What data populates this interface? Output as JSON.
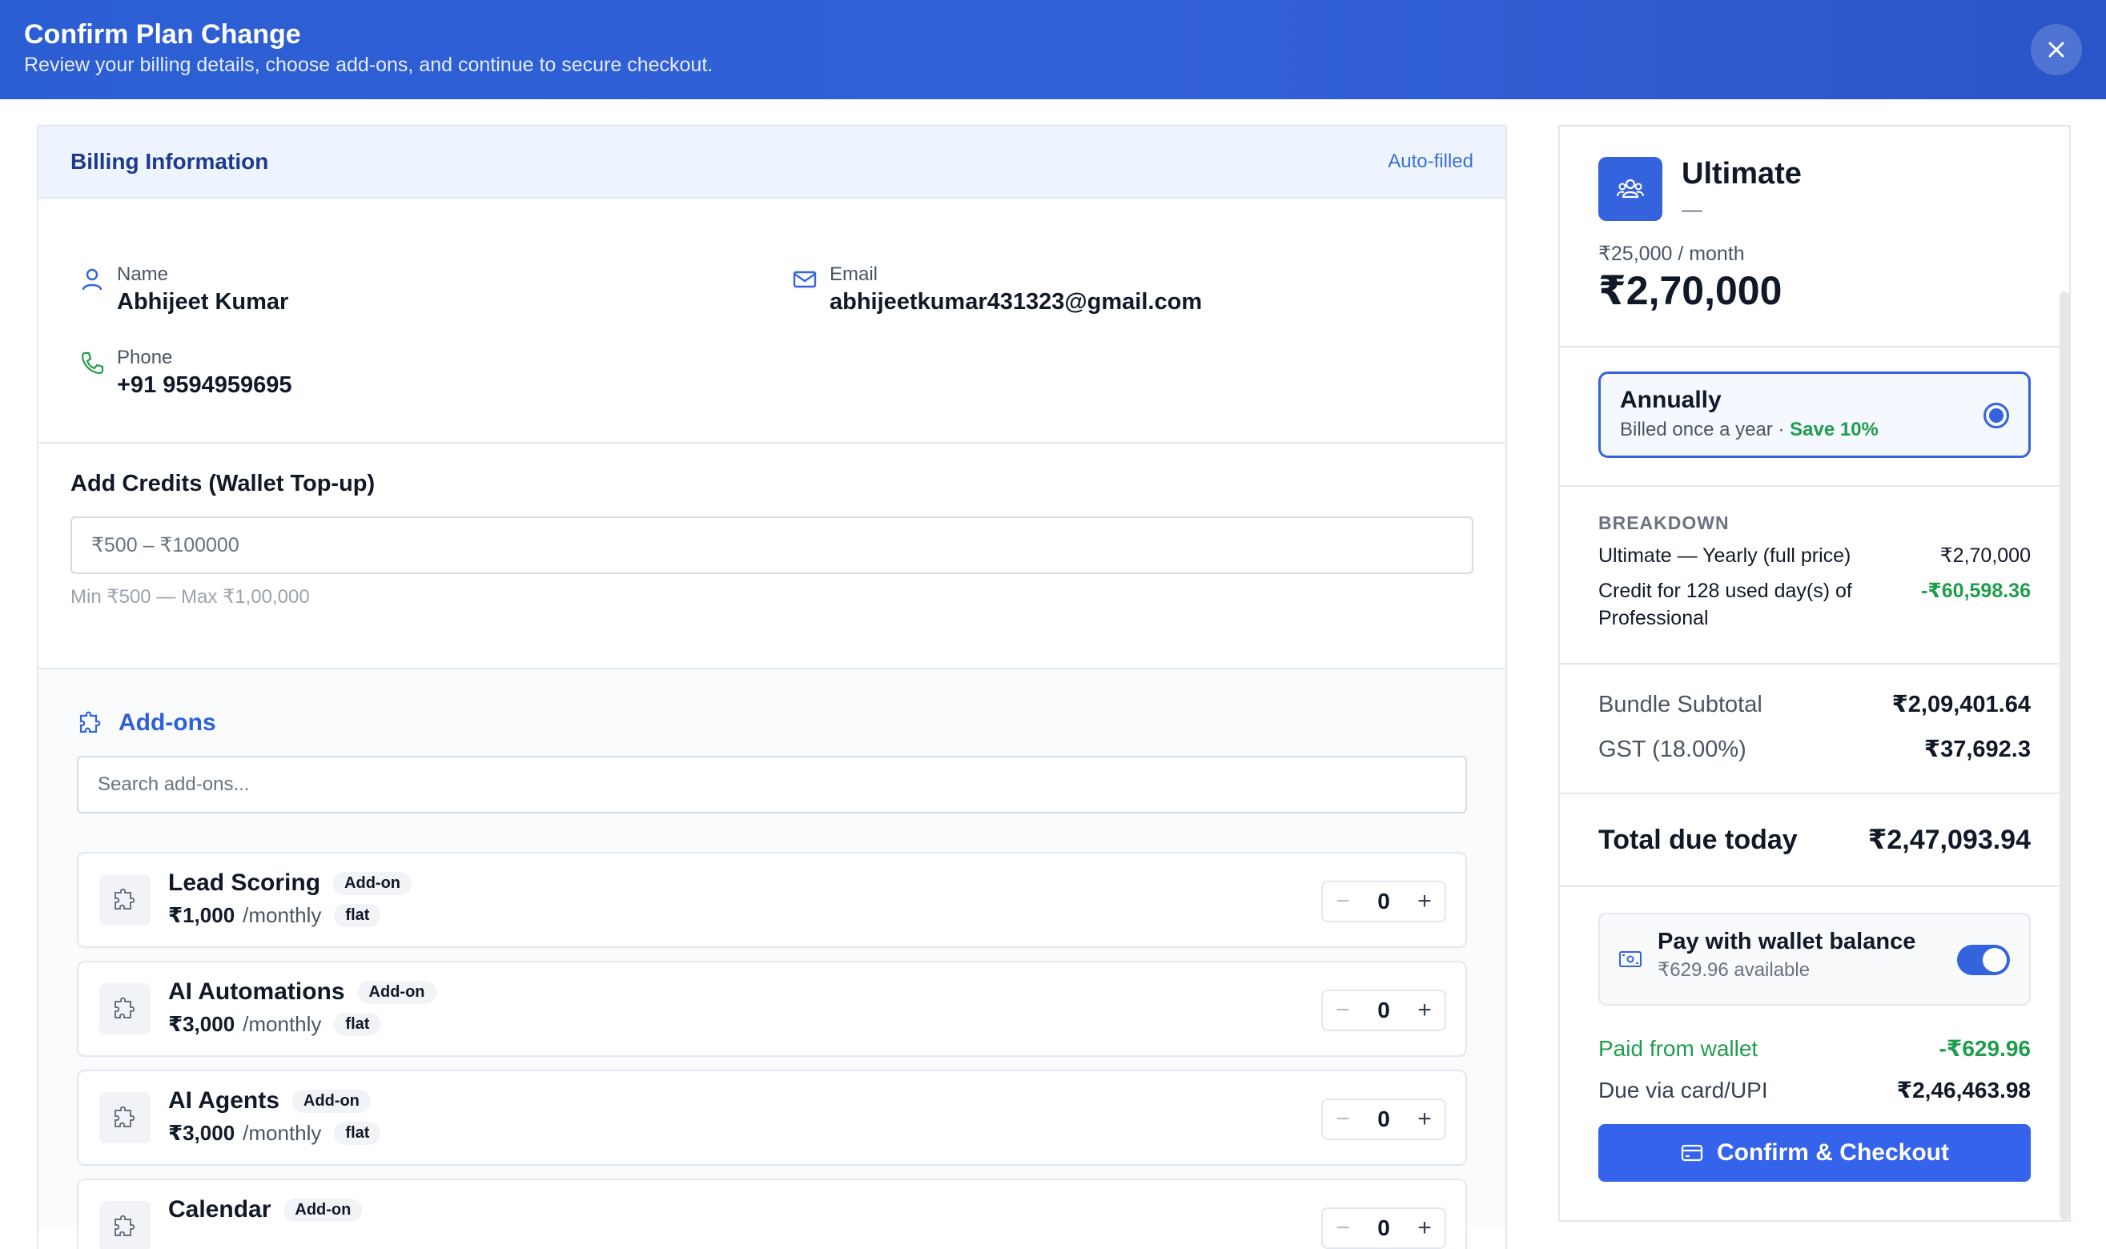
{
  "header": {
    "title": "Confirm Plan Change",
    "subtitle": "Review your billing details, choose add-ons, and continue to secure checkout."
  },
  "billing": {
    "title": "Billing Information",
    "badge": "Auto-filled",
    "name_label": "Name",
    "name_value": "Abhijeet Kumar",
    "email_label": "Email",
    "email_value": "abhijeetkumar431323@gmail.com",
    "phone_label": "Phone",
    "phone_value": "+91 9594959695"
  },
  "credits": {
    "title": "Add Credits (Wallet Top-up)",
    "placeholder": "₹500 – ₹100000",
    "hint": "Min ₹500 — Max ₹1,00,000"
  },
  "addons": {
    "title": "Add-ons",
    "search_placeholder": "Search add-ons...",
    "items": [
      {
        "name": "Lead Scoring",
        "tag": "Add-on",
        "price": "₹1,000",
        "period": "/monthly",
        "type": "flat",
        "qty": "0"
      },
      {
        "name": "AI Automations",
        "tag": "Add-on",
        "price": "₹3,000",
        "period": "/monthly",
        "type": "flat",
        "qty": "0"
      },
      {
        "name": "AI Agents",
        "tag": "Add-on",
        "price": "₹3,000",
        "period": "/monthly",
        "type": "flat",
        "qty": "0"
      },
      {
        "name": "Calendar",
        "tag": "Add-on",
        "price": "",
        "period": "",
        "type": "",
        "qty": "0"
      }
    ]
  },
  "plan": {
    "name": "Ultimate",
    "dash": "—",
    "monthly": "₹25,000 / month",
    "total": "₹2,70,000"
  },
  "cycle": {
    "title": "Annually",
    "subtitle": "Billed once a year ·",
    "save": "Save 10%"
  },
  "breakdown": {
    "title": "BREAKDOWN",
    "line1_label": "Ultimate — Yearly (full price)",
    "line1_value": "₹2,70,000",
    "line2_label": "Credit for 128 used day(s) of Professional",
    "line2_value": "-₹60,598.36"
  },
  "summary": {
    "subtotal_label": "Bundle Subtotal",
    "subtotal_value": "₹2,09,401.64",
    "gst_label": "GST (18.00%)",
    "gst_value": "₹37,692.3",
    "total_label": "Total due today",
    "total_value": "₹2,47,093.94"
  },
  "wallet": {
    "title": "Pay with wallet balance",
    "available": "₹629.96 available",
    "enabled": true,
    "paid_label": "Paid from wallet",
    "paid_value": "-₹629.96",
    "due_label": "Due via card/UPI",
    "due_value": "₹2,46,463.98"
  },
  "checkout": {
    "label": "Confirm & Checkout"
  },
  "colors": {
    "primary": "#3563dd",
    "green": "#1f9d4d",
    "header": "#2b5dd3"
  }
}
